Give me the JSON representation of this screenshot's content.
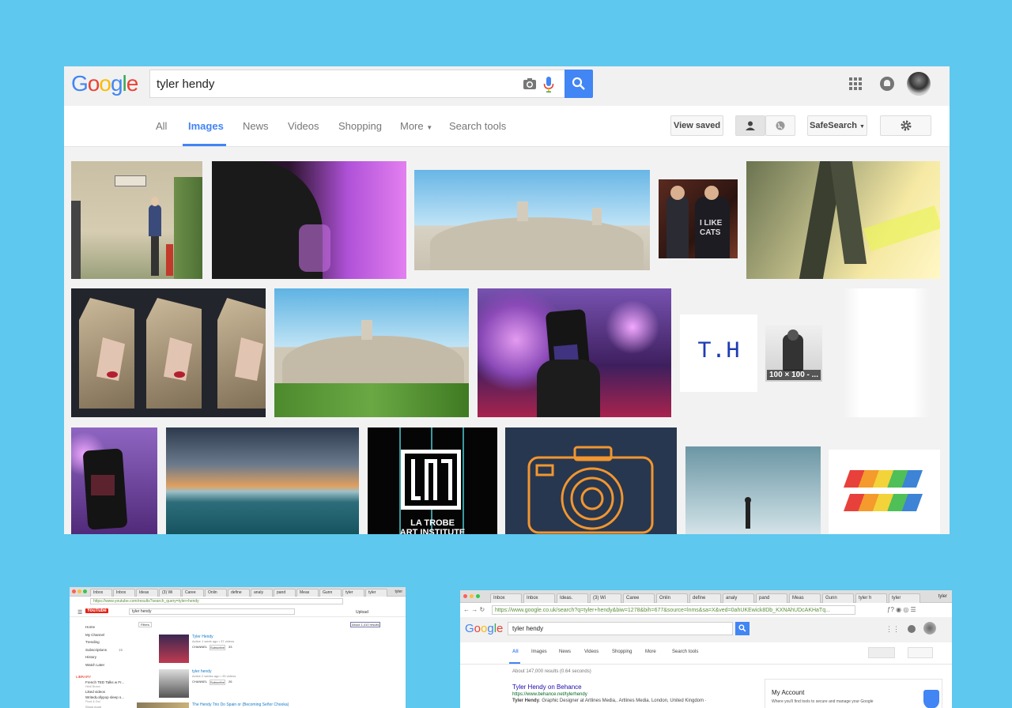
{
  "search": {
    "query": "tyler hendy"
  },
  "logo": {
    "letters": [
      {
        "ch": "G",
        "color": "#4285f4"
      },
      {
        "ch": "o",
        "color": "#ea4335"
      },
      {
        "ch": "o",
        "color": "#fbbc05"
      },
      {
        "ch": "g",
        "color": "#4285f4"
      },
      {
        "ch": "l",
        "color": "#34a853"
      },
      {
        "ch": "e",
        "color": "#ea4335"
      }
    ]
  },
  "nav": {
    "tabs": [
      "All",
      "Images",
      "News",
      "Videos",
      "Shopping",
      "More",
      "Search tools"
    ],
    "active_tab": "Images",
    "view_saved": "View saved",
    "safesearch": "SafeSearch"
  },
  "images": {
    "th_label": "T.H",
    "size_badge": "100 × 100 - ...",
    "shirt_text_1": "I LIKE",
    "shirt_text_2": "CATS",
    "latrobe_text": "LA TROBE",
    "latrobe_text_2": "ART INSTITUTE"
  },
  "youtube_window": {
    "tabs": [
      "Inbox",
      "Inbox",
      "Ideas",
      "(3) Wi",
      "Caree",
      "Onlin",
      "define",
      "analy",
      "pand",
      "Meas",
      "Gunn",
      "tyler",
      "tyler"
    ],
    "user": "tyler",
    "address": "https://www.youtube.com/results?search_query=tyler+hendy",
    "brand": "YouTube",
    "search_value": "tyler hendy",
    "upload": "Upload",
    "filters": "Filters",
    "results_count": "About 1,410 results",
    "sidebar": [
      "Home",
      "My Channel",
      "Trending",
      "Subscriptions",
      "History",
      "Watch Later"
    ],
    "subscriptions_count": "15",
    "library_label": "LIBRARY",
    "library_items": [
      "French TED Talks w Fr...",
      "Liked videos",
      "WritedLollypop sleep s..."
    ],
    "library_sub_1": "Heidi Brown",
    "library_sub_2": "Flock & Owl",
    "show_more": "Show more",
    "results": [
      {
        "title": "Tyler Hendy",
        "meta": "Active 1 week ago • 37 videos",
        "channel": "CHANNEL",
        "subscribe": "Subscribe",
        "count": "33"
      },
      {
        "title": "tyler hendy",
        "meta": "Active 2 weeks ago • 33 videos",
        "channel": "CHANNEL",
        "subscribe": "Subscribe",
        "count": "26"
      }
    ],
    "third_title": "The Hendy Trio Do Spain or (Becoming Señor Chooka)"
  },
  "google_window": {
    "tabs": [
      "Inbox",
      "Inbox",
      "Ideas.",
      "(3) Wi",
      "Caree",
      "Onlin",
      "define",
      "analy",
      "pand",
      "Meas",
      "Gunn",
      "tyler h",
      "tyler"
    ],
    "user": "tyler",
    "address": "https://www.google.co.uk/search?q=tyler+hendy&biw=1278&bih=677&source=lnms&sa=X&ved=0ahUKEwick8Db_KXNAhUDcAKHaTq...",
    "search_value": "tyler hendy",
    "tabs_nav": [
      "All",
      "Images",
      "News",
      "Videos",
      "Shopping",
      "More",
      "Search tools"
    ],
    "stats": "About 147,000 results (0.64 seconds)",
    "result_title": "Tyler Hendy on Behance",
    "result_url": "https://www.behance.net/tylerhendy",
    "result_snippet_bold": "Tyler Hendy",
    "result_snippet": ". Graphic Designer at Artlines Media,. Artlines Media. London, United Kingdom ·",
    "account_title": "My Account",
    "account_text": "Where you'll find tools to secure and manage your Google"
  }
}
